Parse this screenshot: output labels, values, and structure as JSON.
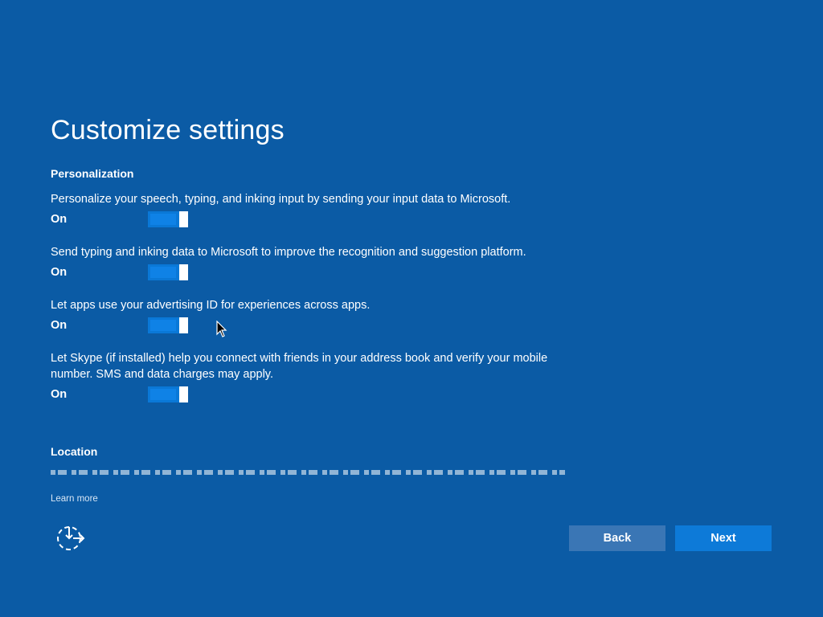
{
  "page": {
    "title": "Customize settings",
    "colors": {
      "background": "#0b5ba5",
      "toggle_on": "#0a78d7",
      "button_next": "#0d7ad8",
      "button_back": "#3a76b5"
    }
  },
  "personalization": {
    "heading": "Personalization",
    "settings": [
      {
        "description": "Personalize your speech, typing, and inking input by sending your input data to Microsoft.",
        "state": "On"
      },
      {
        "description": "Send typing and inking data to Microsoft to improve the recognition and suggestion platform.",
        "state": "On"
      },
      {
        "description": "Let apps use your advertising ID for experiences across apps.",
        "state": "On"
      },
      {
        "description": "Let Skype (if installed) help you connect with friends in your address book and verify your mobile number. SMS and data charges may apply.",
        "state": "On"
      }
    ]
  },
  "location": {
    "heading": "Location"
  },
  "footer": {
    "learn_more": "Learn more",
    "ease_of_access_icon": "ease-of-access-icon",
    "back_label": "Back",
    "next_label": "Next"
  }
}
